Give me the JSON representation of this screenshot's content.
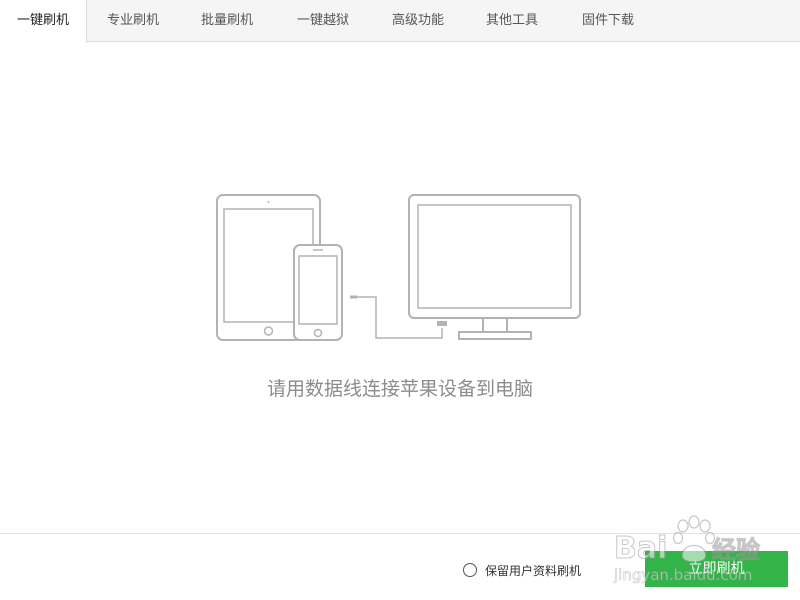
{
  "tabs": [
    {
      "label": "一键刷机",
      "active": true
    },
    {
      "label": "专业刷机",
      "active": false
    },
    {
      "label": "批量刷机",
      "active": false
    },
    {
      "label": "一键越狱",
      "active": false
    },
    {
      "label": "高级功能",
      "active": false
    },
    {
      "label": "其他工具",
      "active": false
    },
    {
      "label": "固件下载",
      "active": false
    }
  ],
  "main": {
    "prompt": "请用数据线连接苹果设备到电脑"
  },
  "footer": {
    "keep_data_label": "保留用户资料刷机",
    "keep_data_checked": false,
    "flash_button_label": "立即刷机"
  },
  "watermark": {
    "brand": "Bai",
    "brand_suffix": "经验",
    "url": "jingyan.baidu.com"
  },
  "colors": {
    "accent": "#33b449",
    "illustration_stroke": "#b3b3b3",
    "prompt_text": "#8c8c8c"
  }
}
